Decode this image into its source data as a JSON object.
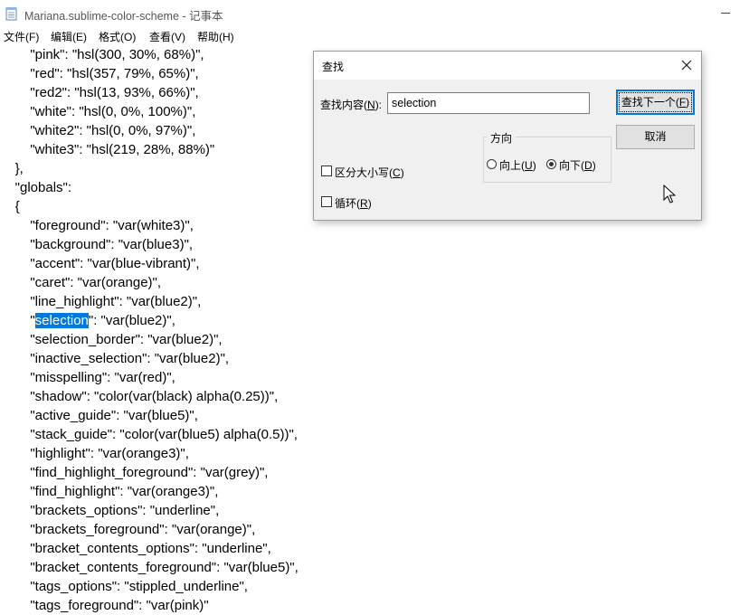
{
  "window": {
    "title": "Mariana.sublime-color-scheme - 记事本",
    "app_icon": "notepad-icon"
  },
  "menu": [
    {
      "label": "文件(F)"
    },
    {
      "label": "编辑(E)"
    },
    {
      "label": "格式(O)"
    },
    {
      "label": "查看(V)"
    },
    {
      "label": "帮助(H)"
    }
  ],
  "editor": {
    "lines": [
      "        \"pink\": \"hsl(300, 30%, 68%)\",",
      "        \"red\": \"hsl(357, 79%, 65%)\",",
      "        \"red2\": \"hsl(13, 93%, 66%)\",",
      "        \"white\": \"hsl(0, 0%, 100%)\",",
      "        \"white2\": \"hsl(0, 0%, 97%)\",",
      "        \"white3\": \"hsl(219, 28%, 88%)\"",
      "    },",
      "    \"globals\":",
      "    {",
      "        \"foreground\": \"var(white3)\",",
      "        \"background\": \"var(blue3)\",",
      "        \"accent\": \"var(blue-vibrant)\",",
      "        \"caret\": \"var(orange)\",",
      "        \"line_highlight\": \"var(blue2)\",",
      "        \"selection\": \"var(blue2)\",",
      "        \"selection_border\": \"var(blue2)\",",
      "        \"inactive_selection\": \"var(blue2)\",",
      "        \"misspelling\": \"var(red)\",",
      "        \"shadow\": \"color(var(black) alpha(0.25))\",",
      "        \"active_guide\": \"var(blue5)\",",
      "        \"stack_guide\": \"color(var(blue5) alpha(0.5))\",",
      "        \"highlight\": \"var(orange3)\",",
      "        \"find_highlight_foreground\": \"var(grey)\",",
      "        \"find_highlight\": \"var(orange3)\",",
      "        \"brackets_options\": \"underline\",",
      "        \"brackets_foreground\": \"var(orange)\",",
      "        \"bracket_contents_options\": \"underline\",",
      "        \"bracket_contents_foreground\": \"var(blue5)\",",
      "        \"tags_options\": \"stippled_underline\",",
      "        \"tags_foreground\": \"var(pink)\""
    ],
    "selected_line": {
      "before": "        \"",
      "selected": "selection",
      "after": "\": \"var(blue2)\","
    },
    "selection_color": "#0078d7"
  },
  "find_dialog": {
    "title": "查找",
    "find_label": "查找内容",
    "find_label_key": "N",
    "find_value": "selection",
    "find_next_label": "查找下一个",
    "find_next_key": "F",
    "cancel_label": "取消",
    "direction_label": "方向",
    "up_label": "向上",
    "up_key": "U",
    "down_label": "向下",
    "down_key": "D",
    "match_case_label": "区分大小写",
    "match_case_key": "C",
    "wrap_label": "循环",
    "wrap_key": "R",
    "direction_selected": "down",
    "match_case_checked": false,
    "wrap_checked": false,
    "accent_color": "#0078d7"
  }
}
